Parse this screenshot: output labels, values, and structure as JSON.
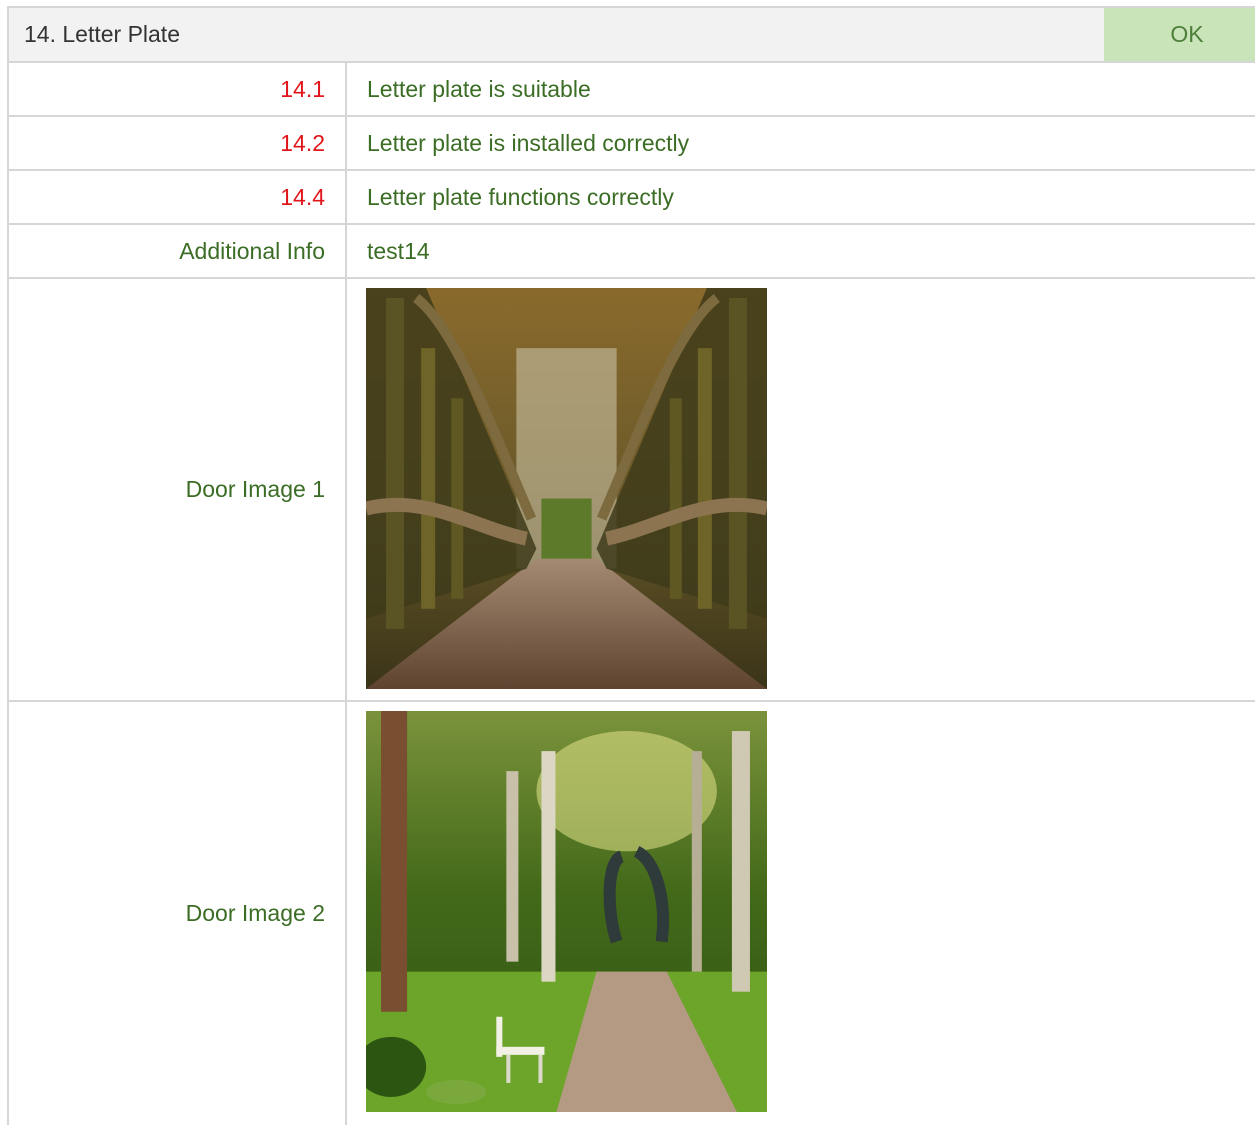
{
  "section": {
    "title": "14. Letter Plate",
    "status": "OK"
  },
  "items": [
    {
      "number": "14.1",
      "text": "Letter plate is suitable"
    },
    {
      "number": "14.2",
      "text": "Letter plate is installed correctly"
    },
    {
      "number": "14.4",
      "text": "Letter plate functions correctly"
    }
  ],
  "additional": {
    "label": "Additional Info",
    "value": "test14"
  },
  "images": [
    {
      "label": "Door Image 1"
    },
    {
      "label": "Door Image 2"
    }
  ]
}
